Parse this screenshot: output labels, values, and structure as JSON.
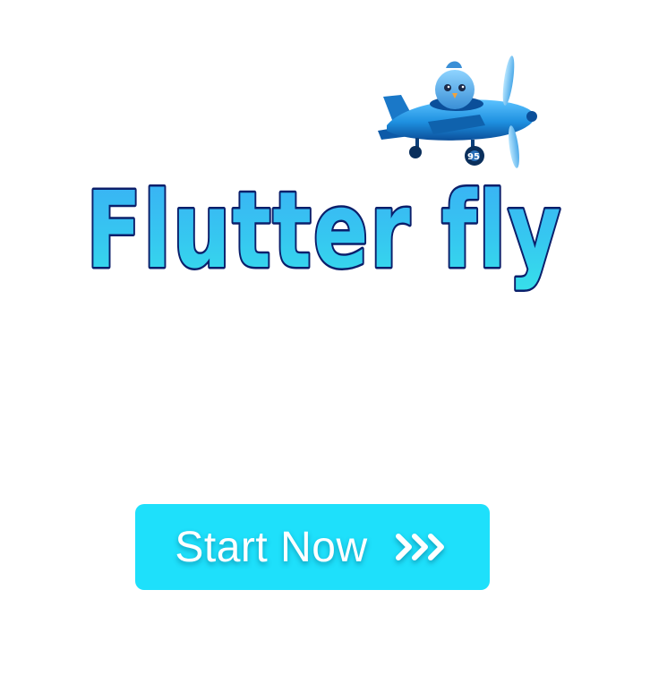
{
  "title": {
    "text": "Flutter fly"
  },
  "mascot": {
    "icon": "flutter-bird-airplane-icon",
    "badge": "95"
  },
  "start_button": {
    "label": "Start Now",
    "icon": "triple-chevron-right-icon"
  },
  "colors": {
    "background": "#ffffff",
    "button": "#1ee0fb",
    "logo_fill_top": "#3aaef5",
    "logo_fill_bottom": "#37e0ea",
    "logo_outline": "#0b1f6b",
    "plane_body": "#1e90e0"
  }
}
